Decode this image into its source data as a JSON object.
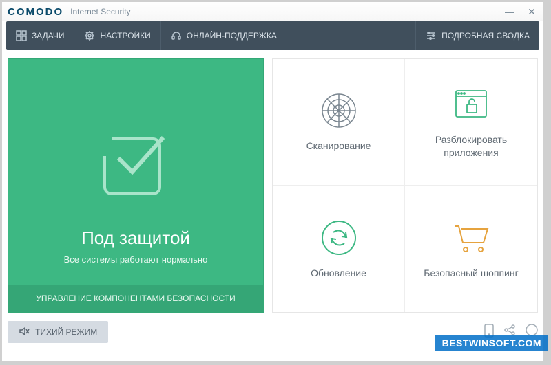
{
  "app": {
    "logo": "COMODO",
    "product": "Internet Security"
  },
  "toolbar": {
    "tasks": "ЗАДАЧИ",
    "settings": "НАСТРОЙКИ",
    "support": "ОНЛАЙН-ПОДДЕРЖКА",
    "summary": "ПОДРОБНАЯ СВОДКА"
  },
  "status": {
    "title": "Под защитой",
    "subtitle": "Все системы работают нормально",
    "footer": "УПРАВЛЕНИЕ КОМПОНЕНТАМИ БЕЗОПАСНОСТИ"
  },
  "tiles": {
    "scan": "Сканирование",
    "unblock": "Разблокировать приложения",
    "update": "Обновление",
    "shopping": "Безопасный шоппинг"
  },
  "bottom": {
    "silent": "ТИХИЙ РЕЖИМ"
  },
  "watermark": "BESTWINSOFT.COM",
  "colors": {
    "toolbar_bg": "#404f5c",
    "status_bg": "#3db883",
    "accent_orange": "#e6a33e"
  }
}
